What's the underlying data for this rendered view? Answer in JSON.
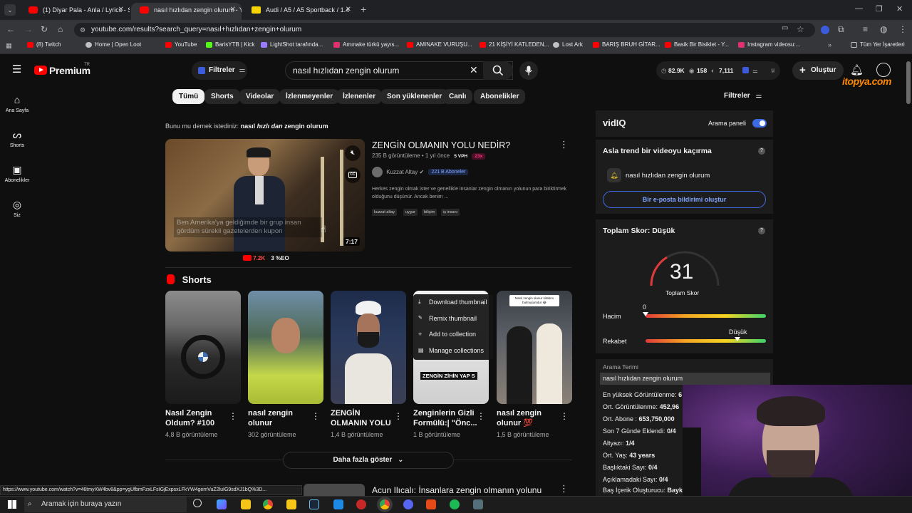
{
  "browser": {
    "tabs": [
      {
        "title": "(1) Diyar Pala - Anla / Lyrics - S",
        "active": false
      },
      {
        "title": "nasıl hızlıdan zengin olurum - Y",
        "active": true
      },
      {
        "title": "Audi / A5 / A5 Sportback / 1.4",
        "active": false
      }
    ],
    "url": "youtube.com/results?search_query=nasıl+hızlıdan+zengin+olurum",
    "bookmarks": [
      "(8) Twitch",
      "Home | Open Loot",
      "YouTube",
      "BarisYTB | Kick",
      "LightShot tarafında...",
      "Amınake türkü yayıs...",
      "AMINAKE VURUŞU...",
      "21 KİŞİYİ KATLEDEN...",
      "Lost Ark",
      "BARIŞ BRUH GİTAR...",
      "Basik Bir Bisiklet - Y...",
      "Instagram videosu:..."
    ],
    "all_bookmarks": "Tüm Yer İşaretleri",
    "status_url": "https://www.youtube.com/watch?v=46tmyXW4bv8&pp=ygUfbmFzxLFsIGjExpsxLFkYW4gemVuZ2luIG9sdXJ1bQ%3D..."
  },
  "youtube": {
    "logo": "Premium",
    "logo_badge": "TR",
    "filters_label": "Filtreler",
    "search_value": "nasıl hızlıdan zengin olurum",
    "stats": [
      "82.9K",
      "158",
      "7,111"
    ],
    "signin": "Oluştur",
    "watermark": "itopya.com",
    "guide": [
      "Ana Sayfa",
      "Shorts",
      "Abonelikler",
      "Siz"
    ],
    "chips": [
      "Tümü",
      "Shorts",
      "Videolar",
      "İzlenmeyenler",
      "İzlenenler",
      "Son yüklenenler",
      "Canlı",
      "Abonelikler"
    ],
    "filters_right": "Filtreler",
    "did_you_mean_prefix": "Bunu mu demek istediniz:",
    "did_you_mean_parts": [
      "nasıl ",
      "hızlı dan",
      " zengin olurum"
    ],
    "video": {
      "title": "ZENGİN OLMANIN YOLU NEDİR?",
      "views": "235 B görüntüleme • 1 yıl önce",
      "vph": "5 VPH",
      "multiplier": "23x",
      "channel": "Kuzzat Altay",
      "subs": "221 B Aboneler",
      "desc": "Herkes zengin olmak ister ve genellikle insanlar zengin olmanın yolunun para biriktirmek olduğunu düşünür. Ancak benim ...",
      "tags": [
        "kuzzat altay",
        "uygur",
        "bilişim",
        "iş insanı"
      ],
      "duration": "7:17",
      "caption": "Ben Amerika'ya geldiğimde bir grup insan gördüm sürekli gazetelerden kupon",
      "stat_likes": "7.2K",
      "stat_eo": "3 %EO"
    },
    "shorts_heading": "Shorts",
    "shorts": [
      {
        "title": "Nasıl Zengin Oldum? #100",
        "views": "4,8 B görüntüleme"
      },
      {
        "title": "nasıl zengin olunur",
        "views": "302 görüntüleme"
      },
      {
        "title": "ZENGİN OLMANIN YOLU",
        "views": "1,4 B görüntüleme"
      },
      {
        "title": "Zenginlerin Gizli Formülü:| \"Önc...",
        "views": "1 B görüntüleme"
      },
      {
        "title": "nasıl zengin olunur 💯",
        "views": "1,5 B görüntüleme"
      }
    ],
    "short4_overlay": "ZENGİN ZİHİN YAP S",
    "short5_caption": "Nasıl zengin olunur kitabını bulmuşumdur 😂",
    "context_menu": [
      "Download thumbnail",
      "Remix thumbnail",
      "Add to collection",
      "Manage collections"
    ],
    "show_more": "Daha fazla göster",
    "next_video_title": "Acun Ilıcalı: İnsanlara zengin olmanın yolunu"
  },
  "vidiq": {
    "logo": "vidIQ",
    "panel_label": "Arama paneli",
    "trend_title": "Asla trend bir videoyu kaçırma",
    "trend_query": "nasıl hızlıdan zengin olurum",
    "email_btn": "Bir e-posta bildirimi oluştur",
    "score_title": "Toplam Skor: Düşük",
    "score_value": "31",
    "score_label": "Toplam Skor",
    "volume_label": "Hacim",
    "volume_value": "0",
    "competition_label": "Rekabet",
    "competition_value": "Düşük",
    "term_label": "Arama Terimi",
    "term_value": "nasıl hızlıdan zengin olurum",
    "stats": [
      {
        "label": "En yüksek Görüntülenme:",
        "value": "6"
      },
      {
        "label": "Ort. Görüntülenme:",
        "value": "452,96"
      },
      {
        "label": "Ort. Abone :",
        "value": "653,750,000"
      },
      {
        "label": "Son 7 Günde Eklendi:",
        "value": "0/4"
      },
      {
        "label": "Altyazı:",
        "value": "1/4"
      },
      {
        "label": "Ort. Yaş:",
        "value": "43 years"
      },
      {
        "label": "Başlıktaki Sayı:",
        "value": "0/4"
      },
      {
        "label": "Açıklamadaki Sayı:",
        "value": "0/4"
      },
      {
        "label": "Baş İçerik Oluşturucu:",
        "value": "Bayk"
      }
    ]
  },
  "taskbar": {
    "search_placeholder": "Aramak için buraya yazın"
  }
}
